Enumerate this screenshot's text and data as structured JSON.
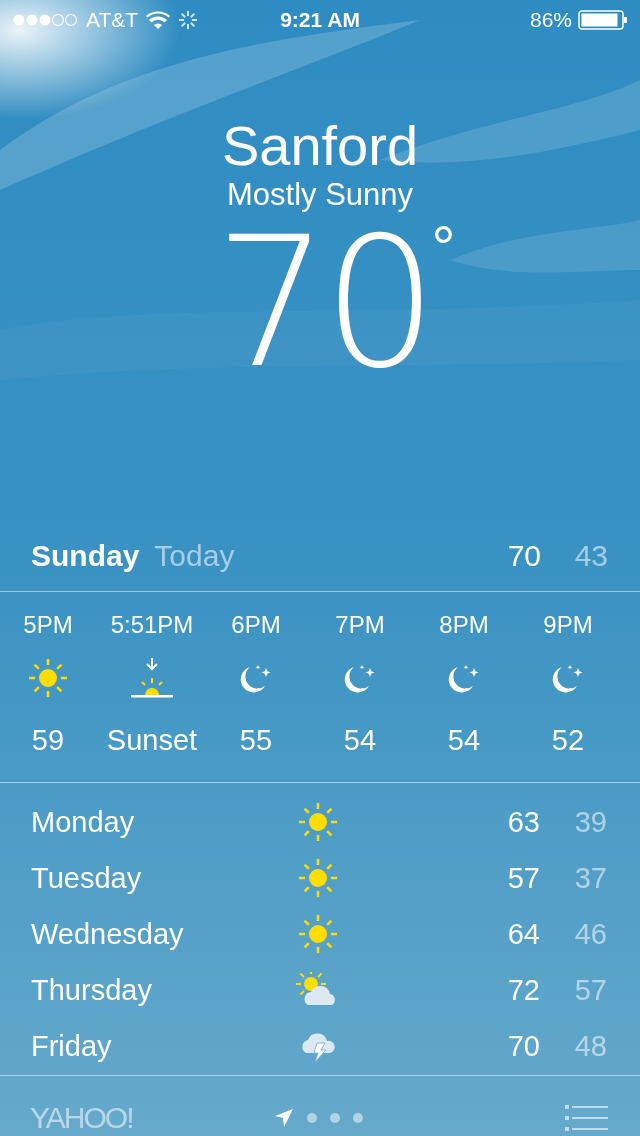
{
  "status_bar": {
    "carrier": "AT&T",
    "time": "9:21 AM",
    "battery": "86%"
  },
  "location": {
    "city": "Sanford",
    "condition": "Mostly Sunny",
    "temperature": "70",
    "degree": "°"
  },
  "today": {
    "day": "Sunday",
    "label": "Today",
    "high": "70",
    "low": "43"
  },
  "hourly": [
    {
      "time": "5PM",
      "kind": "sun",
      "value": "59"
    },
    {
      "time": "5:51PM",
      "kind": "sunset",
      "value": "Sunset"
    },
    {
      "time": "6PM",
      "kind": "moon",
      "value": "55"
    },
    {
      "time": "7PM",
      "kind": "moon",
      "value": "54"
    },
    {
      "time": "8PM",
      "kind": "moon",
      "value": "54"
    },
    {
      "time": "9PM",
      "kind": "moon",
      "value": "52"
    }
  ],
  "daily": [
    {
      "day": "Monday",
      "kind": "sun",
      "high": "63",
      "low": "39"
    },
    {
      "day": "Tuesday",
      "kind": "sun",
      "high": "57",
      "low": "37"
    },
    {
      "day": "Wednesday",
      "kind": "sun",
      "high": "64",
      "low": "46"
    },
    {
      "day": "Thursday",
      "kind": "partly-cloudy",
      "high": "72",
      "low": "57"
    },
    {
      "day": "Friday",
      "kind": "thunderstorm",
      "high": "70",
      "low": "48"
    }
  ],
  "footer": {
    "logo": "YAHOO!",
    "pages": [
      {
        "kind": "location",
        "selected": true
      },
      {
        "kind": "dot",
        "selected": false
      },
      {
        "kind": "dot",
        "selected": false
      },
      {
        "kind": "dot",
        "selected": false
      }
    ]
  }
}
